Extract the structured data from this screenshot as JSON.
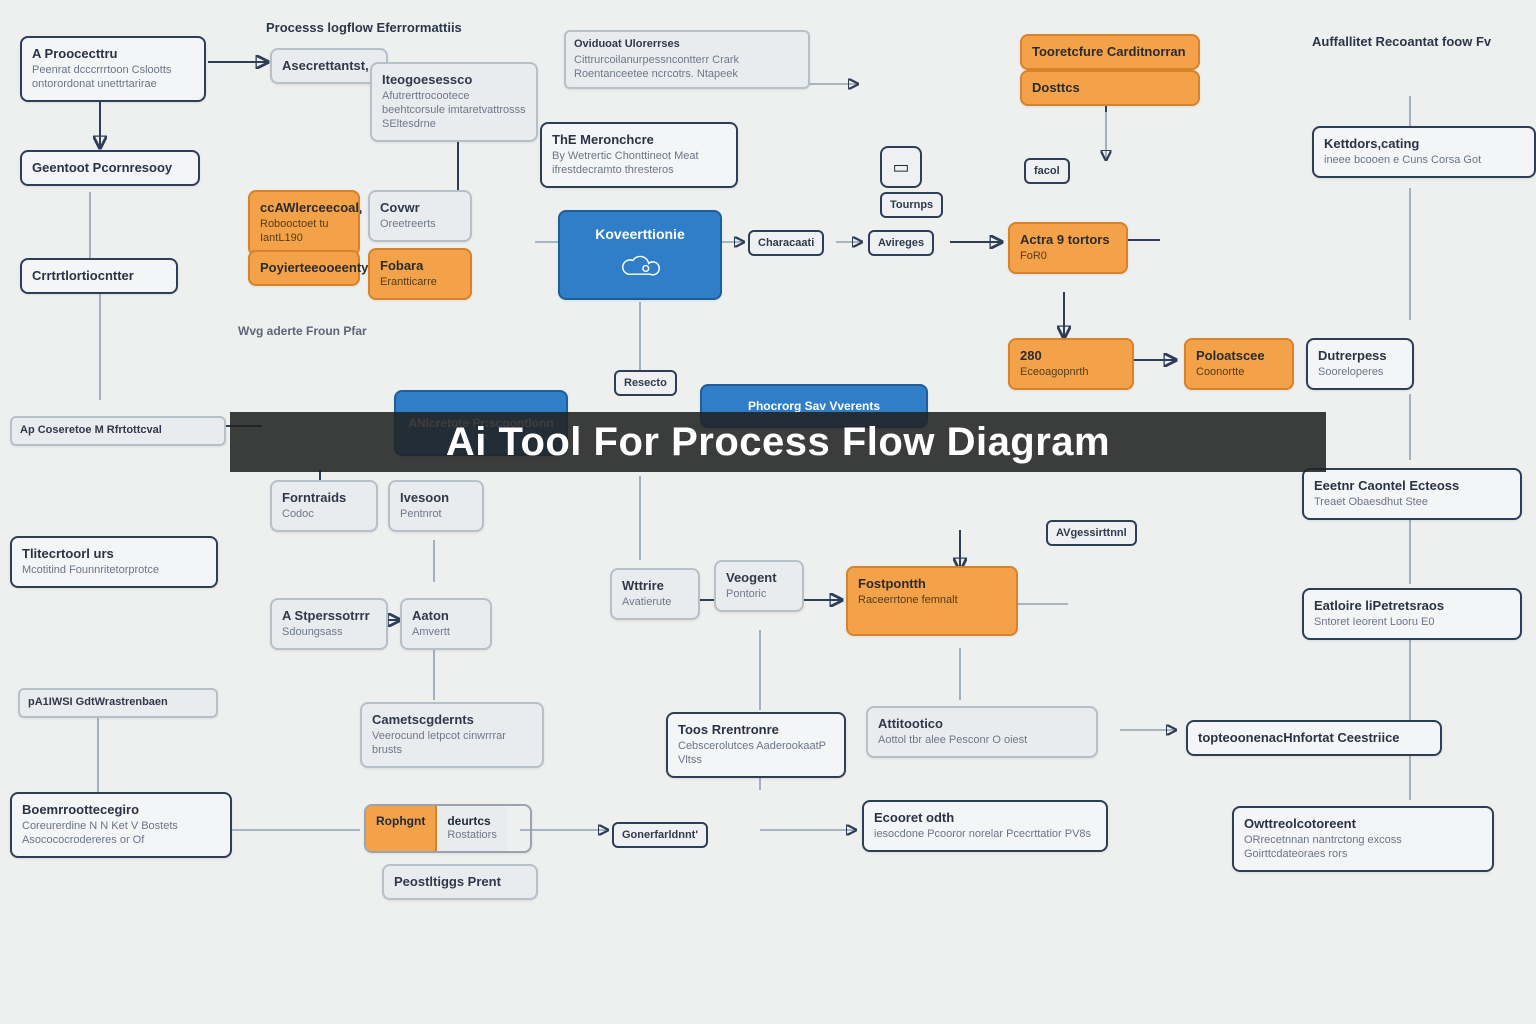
{
  "overlay_title": "Ai Tool For Process Flow Diagram",
  "section_labels": {
    "top_left": "Processs logflow Eferrormattiis",
    "top_right": "Auffallitet Recoantat foow Fv",
    "mid_left": "Wvg aderte Froun Pfar"
  },
  "nodes": {
    "n1": {
      "title": "A Proocecttru",
      "sub": "Peenrat dcccrrrtoon Cslootts\nontorordonat unettrtarirae"
    },
    "n2": {
      "title": "Asecrettantst,",
      "sub": ""
    },
    "n3": {
      "title": "Iteogoesessco",
      "sub": "Afutrerttrocootece\nbeehtcorsule imtaretvattrosss\nSEltesdrne"
    },
    "n4": {
      "title": "Oviduoat Ulorerrses",
      "sub": "Cittrurcoilanurpessncontterr Crark\nRoentanceetee ncrcotrs. Ntapeek"
    },
    "n5": {
      "title": "Tooretcfure Carditnorran"
    },
    "n6": {
      "title": "Dosttcs"
    },
    "n7": {
      "title": "Kettdors,cating",
      "sub": "ineee bcooen e Cuns Corsa Got"
    },
    "n8": {
      "title": "Geentoot Pcornresooy"
    },
    "n9": {
      "title": "ThE Meronchcre",
      "sub": "By Wetrertic Chonttineot\nMeat ifrestdecramto thresteros"
    },
    "n10": {
      "title": "Tournps"
    },
    "n11": {
      "title": "facol"
    },
    "n12": {
      "title": "ccAWlerceecoal",
      "sub": "Robooctoet tu IantL190"
    },
    "n13": {
      "title": "Covwr",
      "sub": "Oreetreerts"
    },
    "n14": {
      "title": "Characaati"
    },
    "n15": {
      "title": "Avireges"
    },
    "n16": {
      "title": "Actra 9 tortors",
      "sub": "FoR0"
    },
    "n17": {
      "title": "Crrtrtlortiocntter"
    },
    "n18": {
      "title": "Poyierteeooeenty"
    },
    "n19": {
      "title": "Fobara",
      "sub": "Erantticarre"
    },
    "n20": {
      "title": "Koveerttionie"
    },
    "n21": {
      "title": "280",
      "sub": "Eceoagopnrth"
    },
    "n22": {
      "title": "Poloatscee",
      "sub": "Coonortte"
    },
    "n23": {
      "title": "Dutrerpess",
      "sub": "Sooreloperes"
    },
    "n24": {
      "title": "Resecto"
    },
    "n25": {
      "title": "Phocrorg Sav Vverents"
    },
    "n26": {
      "title": "ANlcretote Pr:scoontlonn"
    },
    "n27": {
      "title": "Ap Coseretoe M Rfrtottcval"
    },
    "n28": {
      "title": "Forntraids",
      "sub": "Codoc"
    },
    "n29": {
      "title": "Ivesoon",
      "sub": "Pentnrot"
    },
    "n30": {
      "title": "Tlitecrtoorl urs",
      "sub": "Mcotitind Founnritetorprotce"
    },
    "n31": {
      "title": "Wttrire",
      "sub": "Avatierute"
    },
    "n32": {
      "title": "Veogent",
      "sub": "Pontoric"
    },
    "n33": {
      "title": "Fostpontth",
      "sub": "Raceerrtone femnalt"
    },
    "n34": {
      "title": "AVgessirttnnl"
    },
    "n35": {
      "title": "Eeetnr Caontel Ecteoss",
      "sub": "Treaet Obaesdhut Stee"
    },
    "n36": {
      "title": "A Stperssotrrr",
      "sub": "Sdoungsass"
    },
    "n37": {
      "title": "Aaton",
      "sub": "Amvertt"
    },
    "n38": {
      "title": "Eatloire liPetretsraos",
      "sub": "Sntoret Ieorent Looru E0"
    },
    "n39": {
      "title": "pA1IWSI GdtWrastrenbaen"
    },
    "n40": {
      "title": "Cametscgdernts",
      "sub": "Veerocund\nletpcot cinwrrrar brusts"
    },
    "n41": {
      "title": "Toos Rrentronre",
      "sub": "Cebscerolutces\nAaderookaatP Vltss"
    },
    "n42": {
      "title": "Attitootico",
      "sub": "Aottol tbr alee Pesconr  O oiest"
    },
    "n43": {
      "title": "topteoonenacHnfortat Ceestriice"
    },
    "n44": {
      "title": "Boemrroottecegiro",
      "sub": "Coreurerdine N N Ket V Bostets\nAsocococrodereres or Of"
    },
    "n45": {
      "title": "Rophgnt"
    },
    "n46": {
      "title": "deurtcs",
      "sub": "Rostatiors"
    },
    "n47": {
      "title": "Gonerfarldnnt'"
    },
    "n48": {
      "title": "Ecooret odth",
      "sub": "iesocdone\nPcooror norelar Pcecrttatior PV8s"
    },
    "n49": {
      "title": "Owttreolcotoreent",
      "sub": "ORrecetnnan nantrctong excoss\nGoirttcdateoraes rors"
    },
    "n50": {
      "title": "Peostltiggs Prent"
    }
  }
}
